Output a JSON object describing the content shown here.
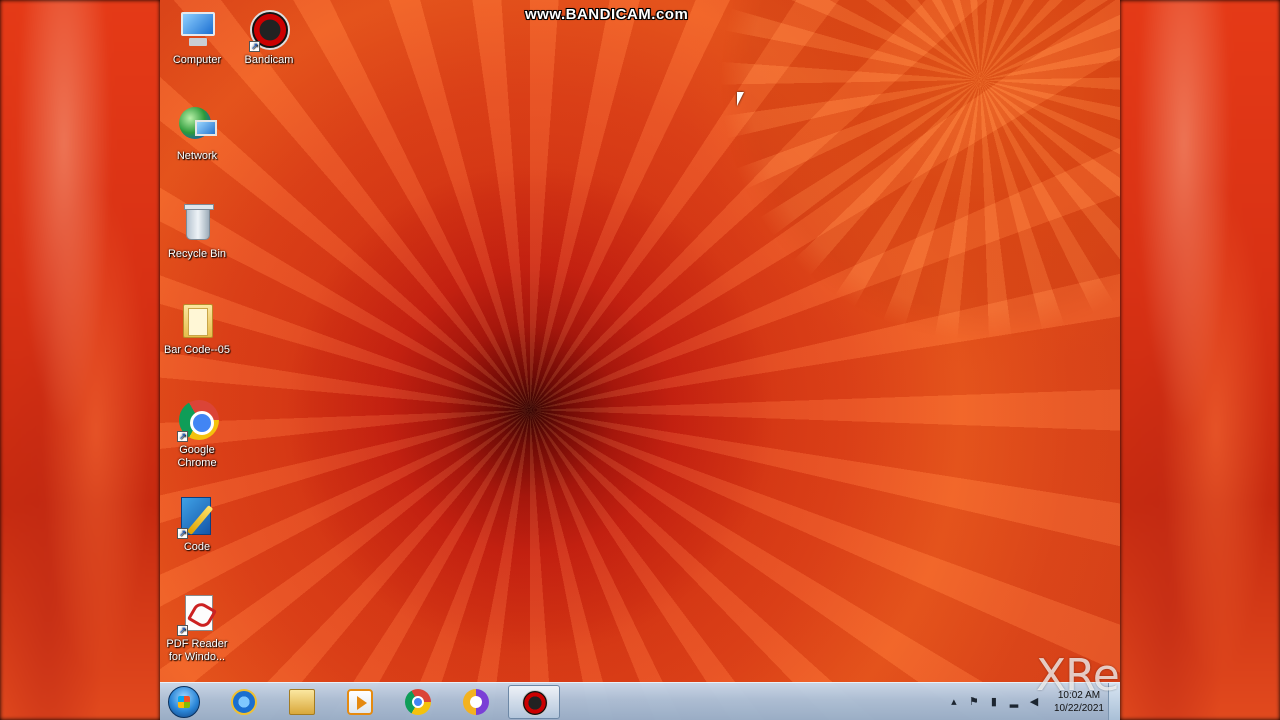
{
  "watermark_top": "www.BANDICAM.com",
  "watermark_bottom": "XRecorder",
  "desktop": {
    "icons": [
      {
        "label": "Computer"
      },
      {
        "label": "Bandicam"
      },
      {
        "label": "Network"
      },
      {
        "label": "Recycle Bin"
      },
      {
        "label": "Bar Code--05"
      },
      {
        "label": "Google\nChrome"
      },
      {
        "label": "Code"
      },
      {
        "label": "PDF Reader\nfor Windo..."
      }
    ]
  },
  "taskbar": {
    "clock_time": "10:02 AM",
    "clock_date": "10/22/2021",
    "pinned": [
      "start",
      "internet-explorer",
      "windows-explorer",
      "media-player",
      "chrome",
      "browser",
      "bandicam"
    ],
    "active": "bandicam",
    "colors": {
      "accent": "#aac3dc"
    }
  }
}
